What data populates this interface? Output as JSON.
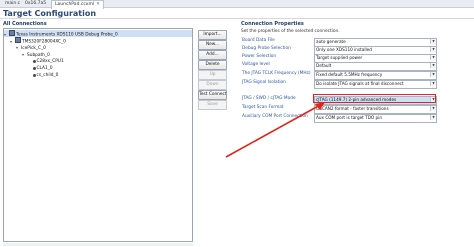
{
  "tabs": [
    {
      "label": "main.c",
      "active": false
    },
    {
      "label": "0x16.7a5",
      "active": false
    },
    {
      "label": "LaunchPad.ccxml",
      "active": true
    }
  ],
  "page_title": "Target Configuration",
  "connections": {
    "title": "All Connections",
    "tree": [
      {
        "label": "Texas Instruments XDS110 USB Debug Probe_0",
        "icon": "chip-icon"
      },
      {
        "label": "TMS320F28004XC_0",
        "icon": "chip-icon"
      },
      {
        "label": "IcePick_C_0",
        "icon": ""
      },
      {
        "label": "Subpath_0",
        "icon": ""
      },
      {
        "label": "C28xx_CPU1",
        "icon": "dot-icon"
      },
      {
        "label": "CLA1_0",
        "icon": "dot-icon"
      },
      {
        "label": "cs_child_0",
        "icon": "dot-icon"
      }
    ]
  },
  "buttons": {
    "import": "Import...",
    "new": "New...",
    "add": "Add...",
    "delete": "Delete",
    "up": "Up",
    "down": "Down",
    "test_connection": "Test Connection",
    "save": "Save"
  },
  "properties": {
    "title": "Connection Properties",
    "description": "Set the properties of the selected connection.",
    "rows": [
      {
        "label": "Board Data File",
        "value": "auto generate"
      },
      {
        "label": "Debug Probe Selection",
        "value": "Only one XDS110 installed"
      },
      {
        "label": "Power Selection",
        "value": "Target supplied power"
      },
      {
        "label": "Voltage level",
        "value": "Default"
      },
      {
        "label": "The JTAG TCLK Frequency (MHz)",
        "value": "Fixed default 5.5MHz frequency"
      },
      {
        "label": "JTAG Signal Isolation",
        "value": "Do isolate JTAG signals at final disconnect"
      },
      {
        "label": "JTAG / SWD / cJTAG Mode",
        "value": "cJTAG (1149.7) 2-pin advanced modes"
      },
      {
        "label": "Target Scan Format",
        "value": "OSCAN2 format - faster transitions"
      },
      {
        "label": "Auxiliary COM Port Connection",
        "value": "Aux COM port is target TDO pin"
      }
    ]
  },
  "colors": {
    "highlight": "#e0241a",
    "arrow": "#e0241a",
    "link_label": "#2c57a6",
    "selection": "#cfe0f5"
  }
}
